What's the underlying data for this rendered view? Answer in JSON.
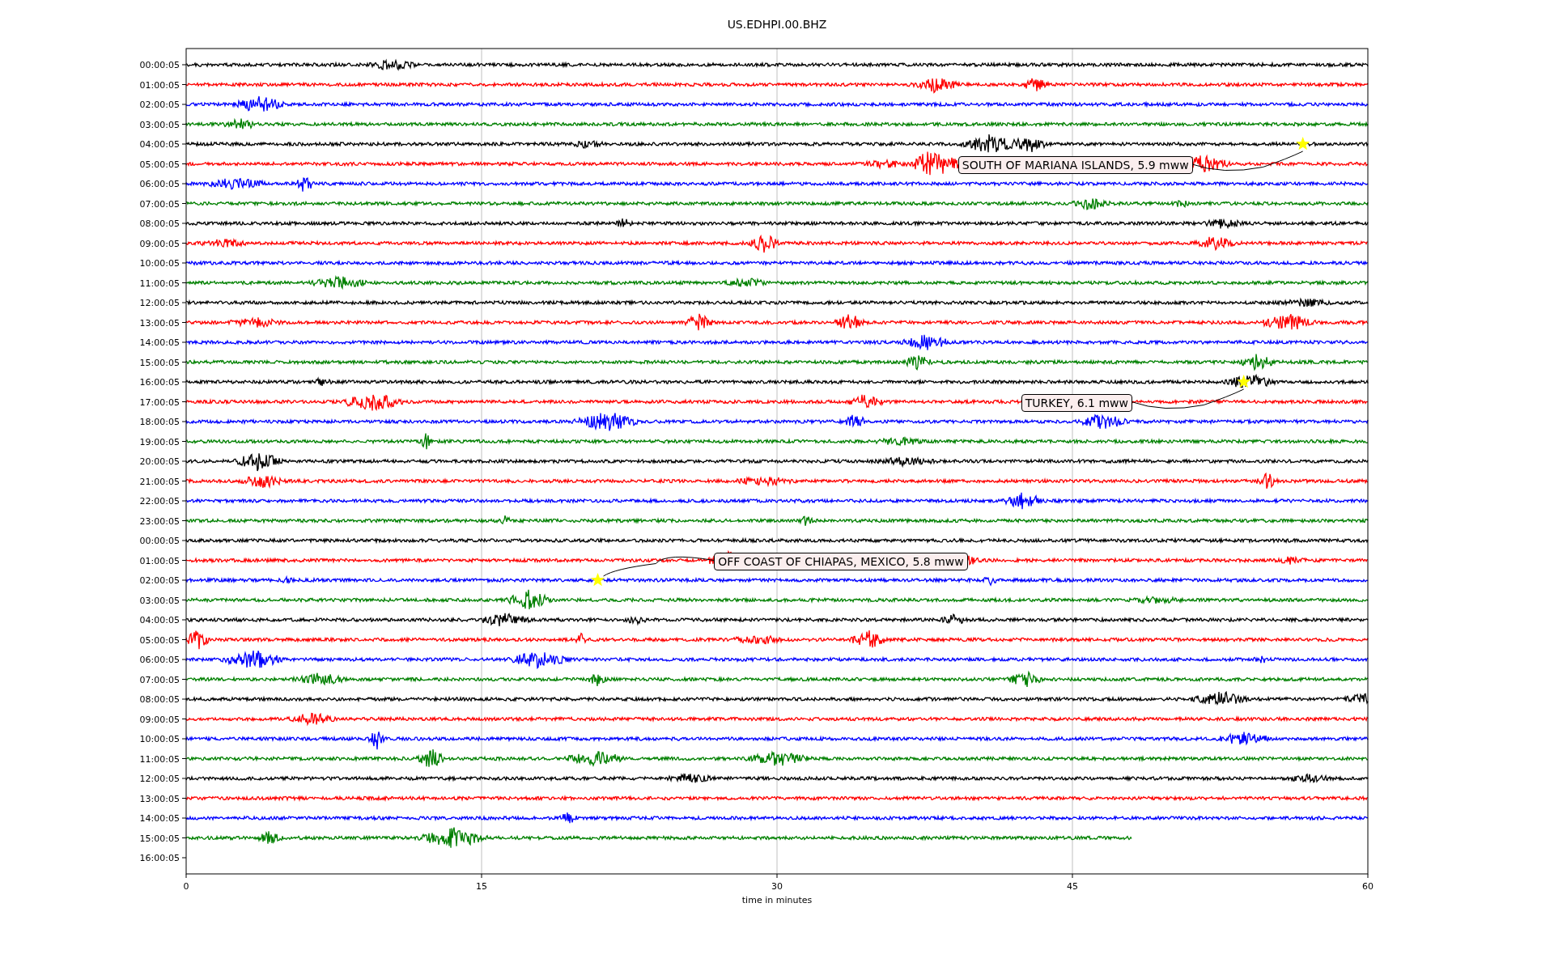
{
  "title": "US.EDHPI.00.BHZ",
  "xlabel": "time in minutes",
  "xticks": [
    "0",
    "15",
    "30",
    "45",
    "60"
  ],
  "rows": [
    {
      "label": "00:00:05",
      "color": "#000000",
      "level": 1
    },
    {
      "label": "01:00:05",
      "color": "#ff0000",
      "level": 1
    },
    {
      "label": "02:00:05",
      "color": "#0000ff",
      "level": 1
    },
    {
      "label": "03:00:05",
      "color": "#008000",
      "level": 1
    },
    {
      "label": "04:00:05",
      "color": "#000000",
      "level": 1,
      "event": "SOUTH OF MARIANA ISLANDS, 5.9 mww"
    },
    {
      "label": "05:00:05",
      "color": "#ff0000",
      "level": 1
    },
    {
      "label": "06:00:05",
      "color": "#0000ff",
      "level": 1
    },
    {
      "label": "07:00:05",
      "color": "#008000",
      "level": 1
    },
    {
      "label": "08:00:05",
      "color": "#000000",
      "level": 1
    },
    {
      "label": "09:00:05",
      "color": "#ff0000",
      "level": 1
    },
    {
      "label": "10:00:05",
      "color": "#0000ff",
      "level": 1
    },
    {
      "label": "11:00:05",
      "color": "#008000",
      "level": 1
    },
    {
      "label": "12:00:05",
      "color": "#000000",
      "level": 1
    },
    {
      "label": "13:00:05",
      "color": "#ff0000",
      "level": 1
    },
    {
      "label": "14:00:05",
      "color": "#0000ff",
      "level": 1
    },
    {
      "label": "15:00:05",
      "color": "#008000",
      "level": 1
    },
    {
      "label": "16:00:05",
      "color": "#000000",
      "level": 1,
      "event": "TURKEY, 6.1 mww"
    },
    {
      "label": "17:00:05",
      "color": "#ff0000",
      "level": 1
    },
    {
      "label": "18:00:05",
      "color": "#0000ff",
      "level": 1
    },
    {
      "label": "19:00:05",
      "color": "#008000",
      "level": 1
    },
    {
      "label": "20:00:05",
      "color": "#000000",
      "level": 1
    },
    {
      "label": "21:00:05",
      "color": "#ff0000",
      "level": 1
    },
    {
      "label": "22:00:05",
      "color": "#0000ff",
      "level": 1
    },
    {
      "label": "23:00:05",
      "color": "#008000",
      "level": 1
    },
    {
      "label": "00:00:05",
      "color": "#000000",
      "level": 1
    },
    {
      "label": "01:00:05",
      "color": "#ff0000",
      "level": 1
    },
    {
      "label": "02:00:05",
      "color": "#0000ff",
      "level": 1,
      "event": "OFF COAST OF CHIAPAS, MEXICO, 5.8 mww"
    },
    {
      "label": "03:00:05",
      "color": "#008000",
      "level": 1
    },
    {
      "label": "04:00:05",
      "color": "#000000",
      "level": 1
    },
    {
      "label": "05:00:05",
      "color": "#ff0000",
      "level": 1
    },
    {
      "label": "06:00:05",
      "color": "#0000ff",
      "level": 1
    },
    {
      "label": "07:00:05",
      "color": "#008000",
      "level": 1
    },
    {
      "label": "08:00:05",
      "color": "#000000",
      "level": 1
    },
    {
      "label": "09:00:05",
      "color": "#ff0000",
      "level": 1
    },
    {
      "label": "10:00:05",
      "color": "#0000ff",
      "level": 1
    },
    {
      "label": "11:00:05",
      "color": "#008000",
      "level": 1
    },
    {
      "label": "12:00:05",
      "color": "#000000",
      "level": 1
    },
    {
      "label": "13:00:05",
      "color": "#ff0000",
      "level": 1
    },
    {
      "label": "14:00:05",
      "color": "#0000ff",
      "level": 1
    },
    {
      "label": "15:00:05",
      "color": "#008000",
      "level": 0.8
    },
    {
      "label": "16:00:05"
    }
  ]
}
